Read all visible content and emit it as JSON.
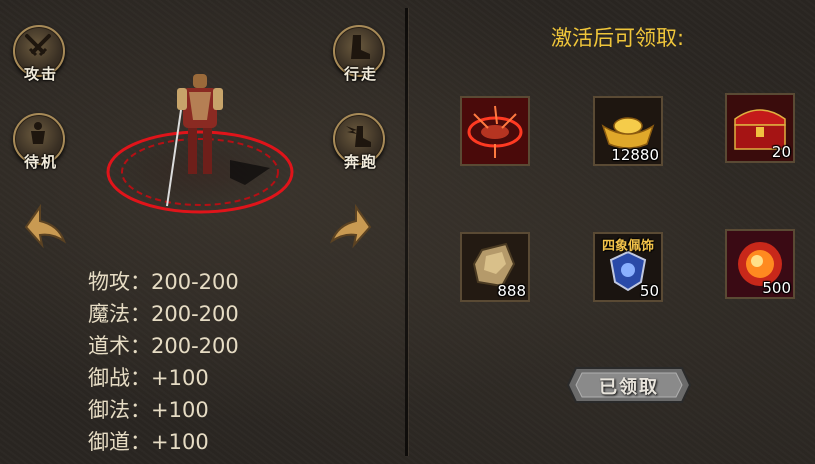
{
  "actions": {
    "attack": {
      "label": "攻击",
      "icon": "crossed-swords-icon"
    },
    "walk": {
      "label": "行走",
      "icon": "boot-icon"
    },
    "idle": {
      "label": "待机",
      "icon": "body-icon"
    },
    "run": {
      "label": "奔跑",
      "icon": "winged-boot-icon"
    }
  },
  "stats": [
    {
      "name": "物攻",
      "value": "200-200"
    },
    {
      "name": "魔法",
      "value": "200-200"
    },
    {
      "name": "道术",
      "value": "200-200"
    },
    {
      "name": "御战",
      "value": "+100"
    },
    {
      "name": "御法",
      "value": "+100"
    },
    {
      "name": "御道",
      "value": "+100"
    }
  ],
  "rewards": {
    "title": "激活后可领取:",
    "items": [
      {
        "icon": "red-magic-ring-icon",
        "quantity": ""
      },
      {
        "icon": "gold-ingot-icon",
        "quantity": "12880"
      },
      {
        "icon": "red-treasure-chest-icon",
        "quantity": "20"
      },
      {
        "icon": "ore-stone-icon",
        "quantity": "888"
      },
      {
        "icon": "blue-emblem-icon",
        "quantity": "50",
        "title": "四象佩饰"
      },
      {
        "icon": "fire-orb-icon",
        "quantity": "500"
      }
    ],
    "claim_label": "已领取"
  },
  "colors": {
    "title": "#f0c63a",
    "frame": "#a88b58",
    "magic_circle": "#e0141a"
  }
}
